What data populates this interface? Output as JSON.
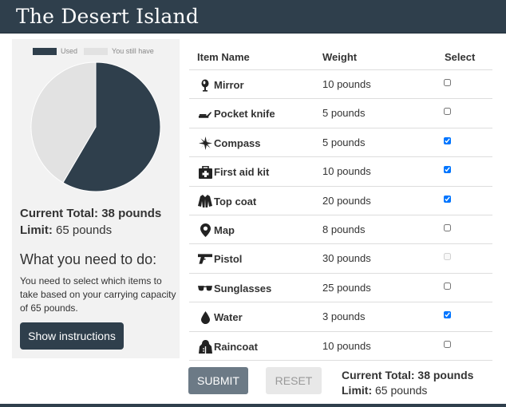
{
  "app_title": "The Desert Island",
  "colors": {
    "brand": "#2f3f4c",
    "used": "#2f3f4c",
    "remaining": "#e2e2e2"
  },
  "legend": {
    "used_label": "Used",
    "have_label": "You still have"
  },
  "chart_data": {
    "type": "pie",
    "categories": [
      "Used",
      "You still have"
    ],
    "values": [
      38,
      27
    ]
  },
  "summary": {
    "current_total_label": "Current Total: 38 pounds",
    "limit_label": "Limit:",
    "limit_value": "65 pounds"
  },
  "instructions": {
    "title": "What you need to do:",
    "text": "You need to select which items to take based on your carrying capacity of 65 pounds.",
    "button": "Show instructions"
  },
  "table": {
    "headers": {
      "name": "Item Name",
      "weight": "Weight",
      "select": "Select"
    },
    "items": [
      {
        "name": "Mirror",
        "weight": "10 pounds",
        "checked": false,
        "disabled": false,
        "icon": "mirror-icon"
      },
      {
        "name": "Pocket knife",
        "weight": "5 pounds",
        "checked": false,
        "disabled": false,
        "icon": "knife-icon"
      },
      {
        "name": "Compass",
        "weight": "5 pounds",
        "checked": true,
        "disabled": false,
        "icon": "compass-icon"
      },
      {
        "name": "First aid kit",
        "weight": "10 pounds",
        "checked": true,
        "disabled": false,
        "icon": "first-aid-icon"
      },
      {
        "name": "Top coat",
        "weight": "20 pounds",
        "checked": true,
        "disabled": false,
        "icon": "coat-icon"
      },
      {
        "name": "Map",
        "weight": "8 pounds",
        "checked": false,
        "disabled": false,
        "icon": "map-marker-icon"
      },
      {
        "name": "Pistol",
        "weight": "30 pounds",
        "checked": false,
        "disabled": true,
        "icon": "pistol-icon"
      },
      {
        "name": "Sunglasses",
        "weight": "25 pounds",
        "checked": false,
        "disabled": false,
        "icon": "sunglasses-icon"
      },
      {
        "name": "Water",
        "weight": "3 pounds",
        "checked": true,
        "disabled": false,
        "icon": "water-drop-icon"
      },
      {
        "name": "Raincoat",
        "weight": "10 pounds",
        "checked": false,
        "disabled": false,
        "icon": "raincoat-icon"
      }
    ]
  },
  "actions": {
    "submit": "SUBMIT",
    "reset": "RESET"
  }
}
